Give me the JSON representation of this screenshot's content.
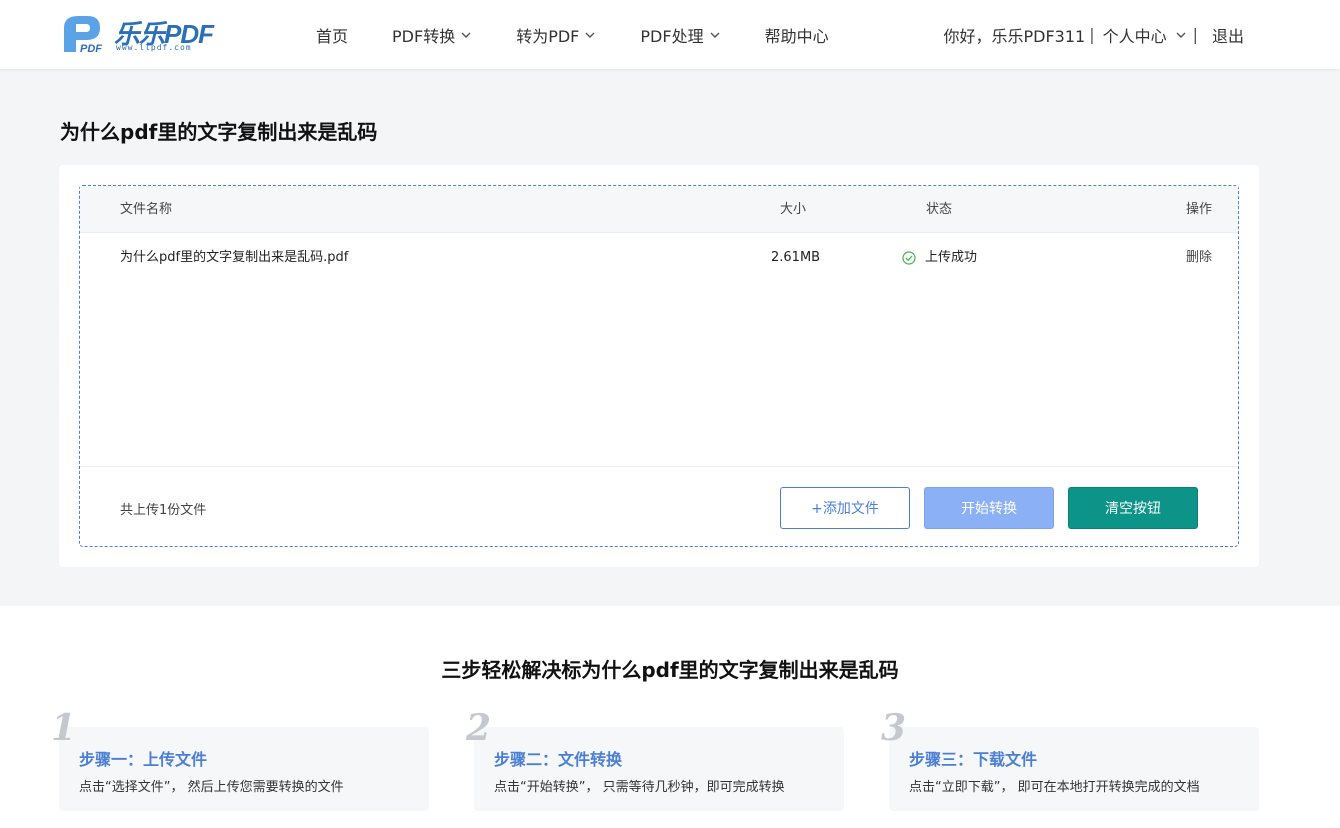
{
  "header": {
    "logo_text": "乐乐PDF",
    "logo_url": "www.llpdf.com",
    "nav": [
      {
        "label": "首页",
        "has_dropdown": false
      },
      {
        "label": "PDF转换",
        "has_dropdown": true
      },
      {
        "label": "转为PDF",
        "has_dropdown": true
      },
      {
        "label": "PDF处理",
        "has_dropdown": true
      },
      {
        "label": "帮助中心",
        "has_dropdown": false
      }
    ],
    "greeting": "你好，乐乐PDF311",
    "personal_center": "个人中心",
    "logout": "退出"
  },
  "page_title": "为什么pdf里的文字复制出来是乱码",
  "table": {
    "columns": {
      "name": "文件名称",
      "size": "大小",
      "status": "状态",
      "op": "操作"
    },
    "rows": [
      {
        "name": "为什么pdf里的文字复制出来是乱码.pdf",
        "size": "2.61MB",
        "status": "上传成功",
        "op": "删除"
      }
    ]
  },
  "footer": {
    "count_text": "共上传1份文件",
    "add_label": "+添加文件",
    "start_label": "开始转换",
    "clear_label": "清空按钮"
  },
  "steps": {
    "title": "三步轻松解决标为什么pdf里的文字复制出来是乱码",
    "items": [
      {
        "num": "1",
        "title": "步骤一：上传文件",
        "desc": "点击“选择文件”， 然后上传您需要转换的文件"
      },
      {
        "num": "2",
        "title": "步骤二：文件转换",
        "desc": "点击“开始转换”， 只需等待几秒钟，即可完成转换"
      },
      {
        "num": "3",
        "title": "步骤三：下载文件",
        "desc": "点击“立即下载”， 即可在本地打开转换完成的文档"
      }
    ]
  },
  "colors": {
    "accent": "#4b7fd6",
    "start_button": "#8cb0f5",
    "clear_button": "#0d9488",
    "success": "#3bb54a"
  }
}
